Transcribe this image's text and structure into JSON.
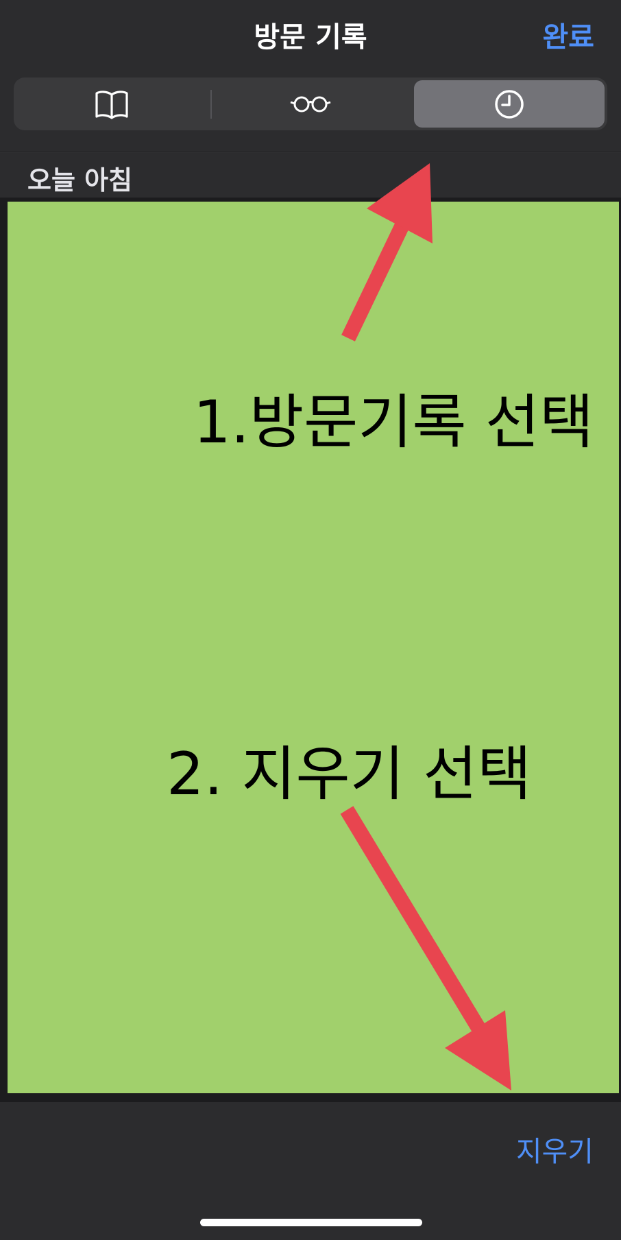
{
  "nav": {
    "title": "방문 기록",
    "done_label": "완료"
  },
  "segments": [
    {
      "icon": "book-icon",
      "selected": false
    },
    {
      "icon": "reading-list-glasses-icon",
      "selected": false
    },
    {
      "icon": "history-clock-icon",
      "selected": true
    }
  ],
  "section": {
    "label": "오늘 아침"
  },
  "overlay": {
    "color": "#a1d06c",
    "arrow_color": "#e8454f",
    "caption_1": "1.방문기록 선택",
    "caption_2": "2. 지우기 선택"
  },
  "toolbar": {
    "clear_label": "지우기"
  },
  "colors": {
    "accent": "#4f8ff7",
    "background": "#2c2c2e"
  }
}
